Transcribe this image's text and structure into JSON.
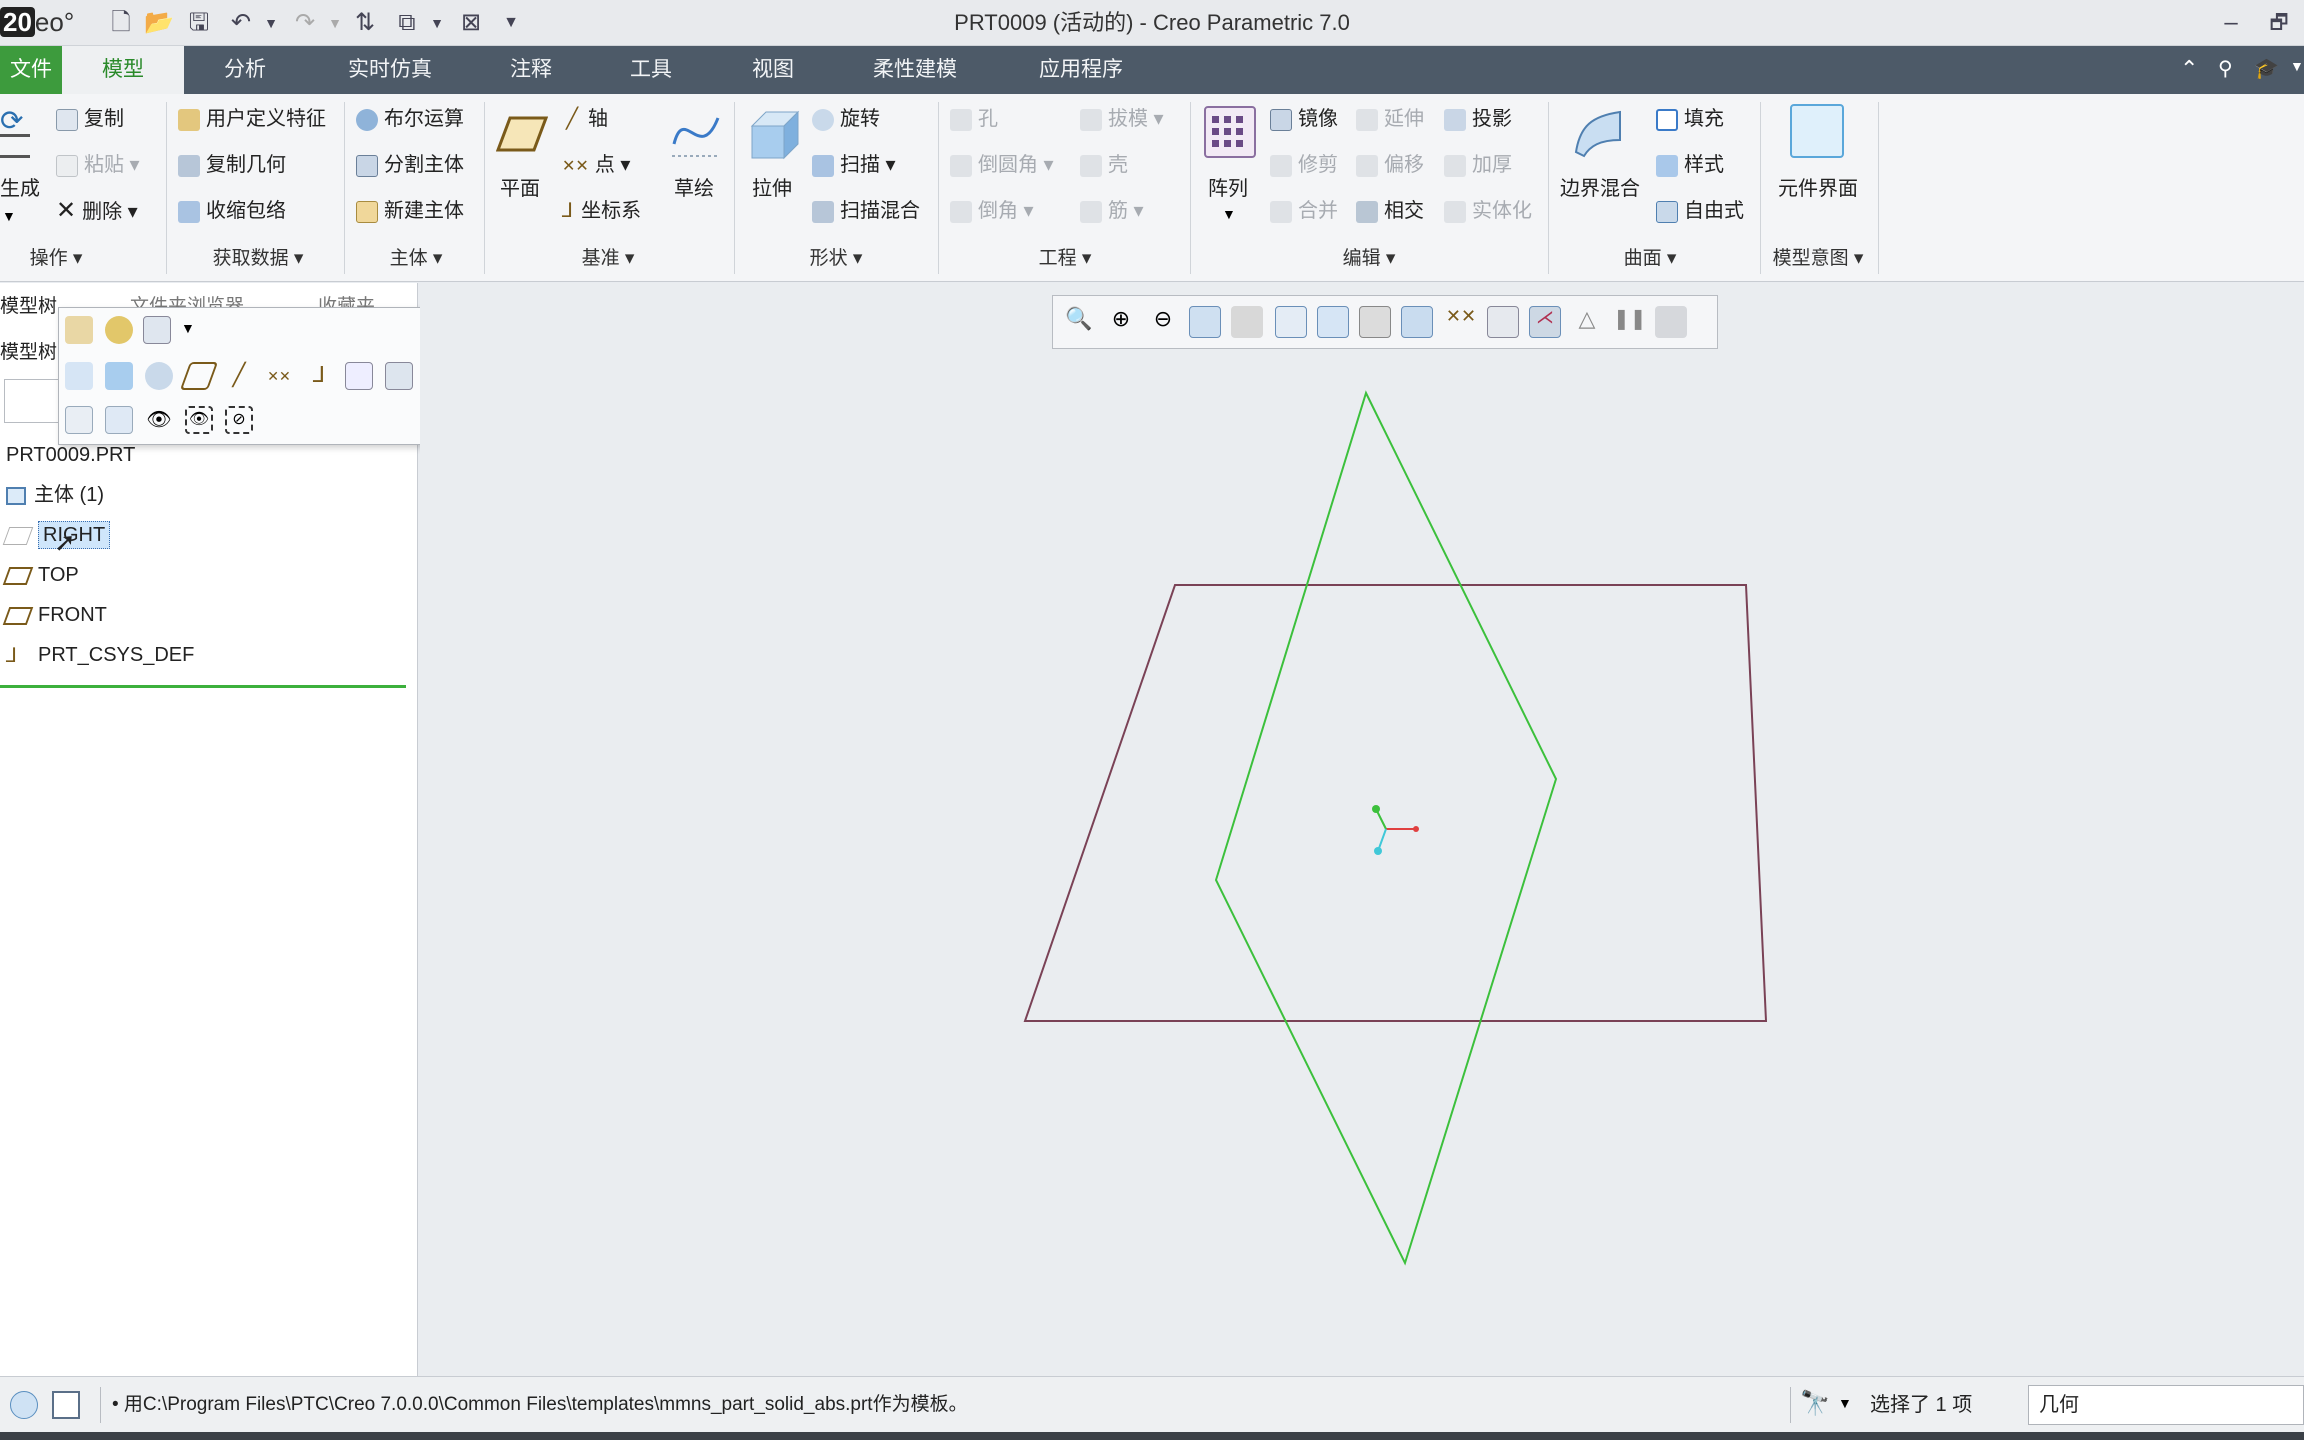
{
  "app": {
    "logo_prefix": "20",
    "logo_text": "eo°",
    "title": "PRT0009 (活动的) - Creo Parametric 7.0"
  },
  "window_controls": {
    "minimize": "–",
    "restore": "🗗"
  },
  "ribbon_tabs": [
    "文件",
    "模型",
    "分析",
    "实时仿真",
    "注释",
    "工具",
    "视图",
    "柔性建模",
    "应用程序"
  ],
  "ribbon": {
    "ops": {
      "regen": "生成",
      "copy": "复制",
      "paste": "粘贴",
      "delete": "删除",
      "label": "操作"
    },
    "data": {
      "udf": "用户定义特征",
      "copy_geom": "复制几何",
      "shrinkwrap": "收缩包络",
      "label": "获取数据"
    },
    "body": {
      "boolean": "布尔运算",
      "split": "分割主体",
      "new_body": "新建主体",
      "label": "主体"
    },
    "datum": {
      "plane": "平面",
      "axis": "轴",
      "point": "点",
      "csys": "坐标系",
      "sketch": "草绘",
      "label": "基准"
    },
    "shape": {
      "extrude": "拉伸",
      "revolve": "旋转",
      "sweep": "扫描",
      "swept_blend": "扫描混合",
      "label": "形状"
    },
    "eng": {
      "hole": "孔",
      "round": "倒圆角",
      "chamfer": "倒角",
      "draft": "拔模",
      "shell": "壳",
      "rib": "筋",
      "label": "工程"
    },
    "edit": {
      "pattern": "阵列",
      "mirror": "镜像",
      "trim": "修剪",
      "merge": "合并",
      "extend": "延伸",
      "offset": "偏移",
      "intersect": "相交",
      "project": "投影",
      "thicken": "加厚",
      "solidify": "实体化",
      "label": "编辑"
    },
    "surface": {
      "boundary": "边界混合",
      "fill": "填充",
      "style": "样式",
      "freestyle": "自由式",
      "label": "曲面"
    },
    "intent": {
      "component": "元件界面",
      "label": "模型意图"
    }
  },
  "left_panel": {
    "tabs": [
      "模型树",
      "文件夹浏览器",
      "收藏夹"
    ],
    "tree_header": "模型树",
    "root": "PRT0009.PRT",
    "items": [
      "主体 (1)",
      "RIGHT",
      "TOP",
      "FRONT",
      "PRT_CSYS_DEF"
    ]
  },
  "status": {
    "message": "• 用C:\\Program Files\\PTC\\Creo 7.0.0.0\\Common Files\\templates\\mmns_part_solid_abs.prt作为模板。",
    "selection": "选择了 1 项",
    "filter": "几何"
  },
  "colors": {
    "file_tab": "#3d9b3d",
    "tab_bar": "#4d5a68",
    "datum_plane_green": "#3cc03c",
    "datum_plane_maroon": "#7a4256",
    "highlight": "#cfe6fb"
  }
}
